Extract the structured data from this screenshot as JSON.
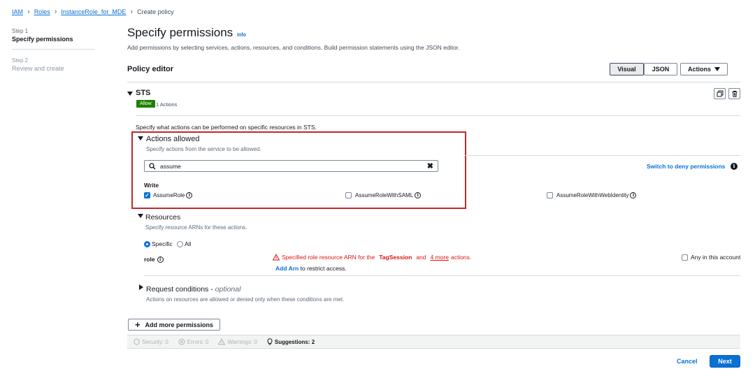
{
  "breadcrumb": [
    "IAM",
    "Roles",
    "InstanceRole_for_MDE",
    "Create policy"
  ],
  "steps": [
    {
      "step": "Step 1",
      "label": "Specify permissions"
    },
    {
      "step": "Step 2",
      "label": "Review and create"
    }
  ],
  "header": {
    "title": "Specify permissions",
    "info": "Info",
    "description": "Add permissions by selecting services, actions, resources, and conditions. Build permission statements using the JSON editor."
  },
  "editor": {
    "title": "Policy editor",
    "visual_label": "Visual",
    "json_label": "JSON",
    "actions_label": "Actions"
  },
  "service": {
    "name": "STS",
    "effect": "Allow",
    "count": "1 Actions",
    "desc": "Specify what actions can be performed on specific resources in STS."
  },
  "actions_allowed": {
    "title": "Actions allowed",
    "desc": "Specify actions from the service to be allowed.",
    "search_value": "assume",
    "switch_label": "Switch to deny permissions",
    "group": "Write",
    "items": [
      {
        "label": "AssumeRole",
        "checked": true
      },
      {
        "label": "AssumeRoleWithSAML",
        "checked": false
      },
      {
        "label": "AssumeRoleWithWebIdentity",
        "checked": false
      }
    ]
  },
  "resources": {
    "title": "Resources",
    "desc": "Specify resource ARNs for these actions.",
    "specific_label": "Specific",
    "all_label": "All",
    "role_label": "role",
    "warning_prefix": "Specified role resource ARN for the",
    "warning_action": "TagSession",
    "warning_and": "and",
    "warning_more": "4 more",
    "warning_suffix": "actions.",
    "add_arn": "Add Arn",
    "add_arn_suffix": "to restrict access.",
    "any_account": "Any in this account"
  },
  "conditions": {
    "title": "Request conditions -",
    "optional": "optional",
    "desc": "Actions on resources are allowed or denied only when these conditions are met."
  },
  "add_more": "Add more permissions",
  "status": {
    "security": "Security: 0",
    "errors": "Errors: 0",
    "warnings": "Warnings: 0",
    "suggestions": "Suggestions: 2"
  },
  "footer": {
    "cancel": "Cancel",
    "next": "Next"
  },
  "colors": {
    "accent": "#0972d3",
    "allow_badge": "#1d8102",
    "warning": "#d91515",
    "highlight_box": "#c0272d"
  }
}
